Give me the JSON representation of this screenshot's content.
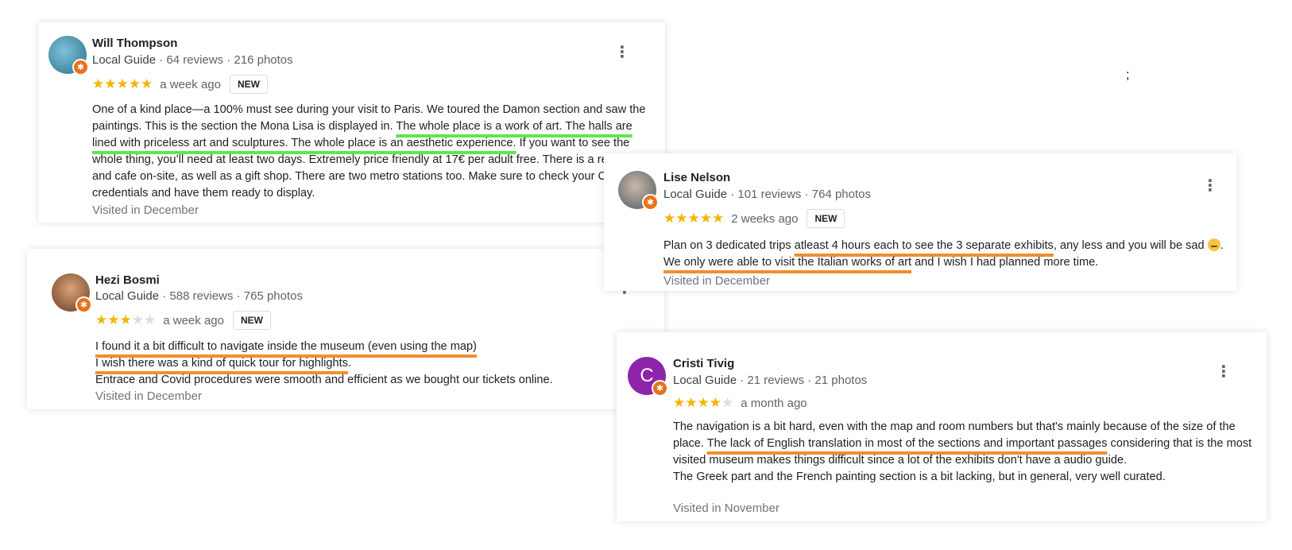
{
  "reviews": [
    {
      "name": "Will Thompson",
      "guide": "Local Guide",
      "stats": " · 64 reviews · 216 photos",
      "stars_filled": 5,
      "stars_total": 5,
      "time": "a week ago",
      "badge": "NEW",
      "text": {
        "p1a": "One of a kind place—a 100% must see during your visit to Paris. We toured the Damon section and saw the paintings. This is the section the Mona Lisa is displayed in. ",
        "hl1": "The whole place is a work of art. The halls are lined with priceless art and sculptures. The whole place is an aesthetic experience.",
        "p1b": " If you want to see the whole thing, you’ll need at least two days. Extremely price friendly at 17€ per adult free. There is a restaurant and cafe on-site, as well as a gift shop. There are two metro stations too. Make sure to check your COVID credentials and have them ready to display."
      },
      "visited": "Visited in December",
      "avatar_color": "#3a8fb0"
    },
    {
      "name": "Hezi Bosmi",
      "guide": "Local Guide",
      "stats": " · 588 reviews · 765 photos",
      "stars_filled": 3,
      "stars_total": 5,
      "time": "a week ago",
      "badge": "NEW",
      "text": {
        "l1": "I found it a bit difficult to navigate inside the museum (even using the map)",
        "l2": "I wish there was a kind of quick tour for highlights",
        "l2end": ".",
        "l3": "Entrace and Covid procedures were smooth and efficient as we bought our tickets online."
      },
      "visited": "Visited in December",
      "avatar_color": "#8a5a3a"
    },
    {
      "name": "Lise Nelson",
      "guide": "Local Guide",
      "stats": " · 101 reviews · 764 photos",
      "stars_filled": 5,
      "stars_total": 5,
      "time": "2 weeks ago",
      "badge": "NEW",
      "text": {
        "a": "Plan on 3 dedicated trips ",
        "hl1": "atleast 4 hours each to see the 3 separate exhibits",
        "b": ", any less and you will be sad ",
        "c": ".  ",
        "hl2": "We only were able to visit the Italian works of art",
        "d": " and I wish I had planned more time."
      },
      "visited": "Visited in December",
      "avatar_color": "#6a7f8a"
    },
    {
      "name": "Cristi Tivig",
      "guide": "Local Guide",
      "stats": " · 21 reviews · 21 photos",
      "stars_filled": 4,
      "stars_total": 5,
      "time": "a month ago",
      "avatar_letter": "C",
      "text": {
        "a": "The navigation is a bit hard, even with the map and room numbers but that's mainly because of the size of the place. ",
        "hl1": "The lack of English translation in most of the sections and important passages",
        "b": " considering that is  the most visited museum makes things difficult since a lot of the exhibits don't have a audio guide.",
        "p2": "The Greek part and the French painting section is a bit lacking, but in general, very well curated."
      },
      "visited": "Visited in November",
      "avatar_color": "#8e24aa"
    }
  ],
  "icons": {
    "star": "★",
    "more": "⋮",
    "guide_badge": "✱"
  },
  "stray_mark": ";",
  "colors": {
    "highlight_green": "#5de84c",
    "highlight_orange": "#ef8f2f",
    "star": "#f4b400"
  }
}
